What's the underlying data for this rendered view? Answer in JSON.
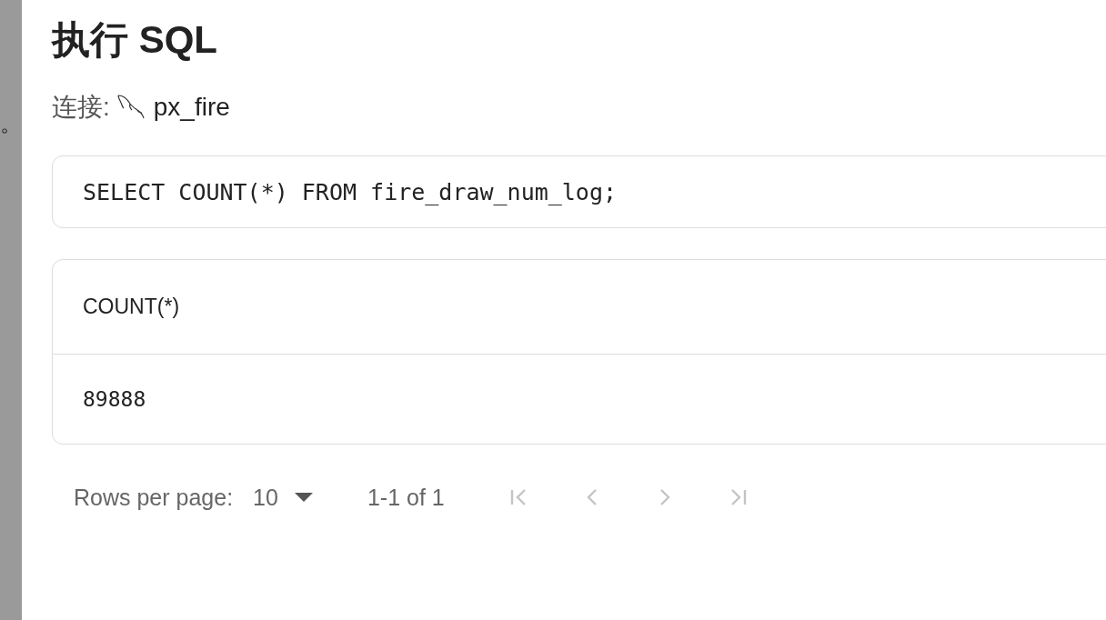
{
  "background": {
    "texts": [
      "。"
    ]
  },
  "dialog": {
    "title": "执行 SQL",
    "connection": {
      "label": "连接:",
      "name": "px_fire"
    },
    "query": "SELECT COUNT(*) FROM fire_draw_num_log;",
    "table": {
      "columns": [
        "COUNT(*)"
      ],
      "rows": [
        [
          "89888"
        ]
      ]
    },
    "pagination": {
      "rows_per_page_label": "Rows per page:",
      "rows_per_page": "10",
      "range": "1-1 of 1",
      "buttons": [
        {
          "kind": "first",
          "disabled": true
        },
        {
          "kind": "prev",
          "disabled": true
        },
        {
          "kind": "next",
          "disabled": true
        },
        {
          "kind": "last",
          "disabled": true
        }
      ]
    }
  }
}
